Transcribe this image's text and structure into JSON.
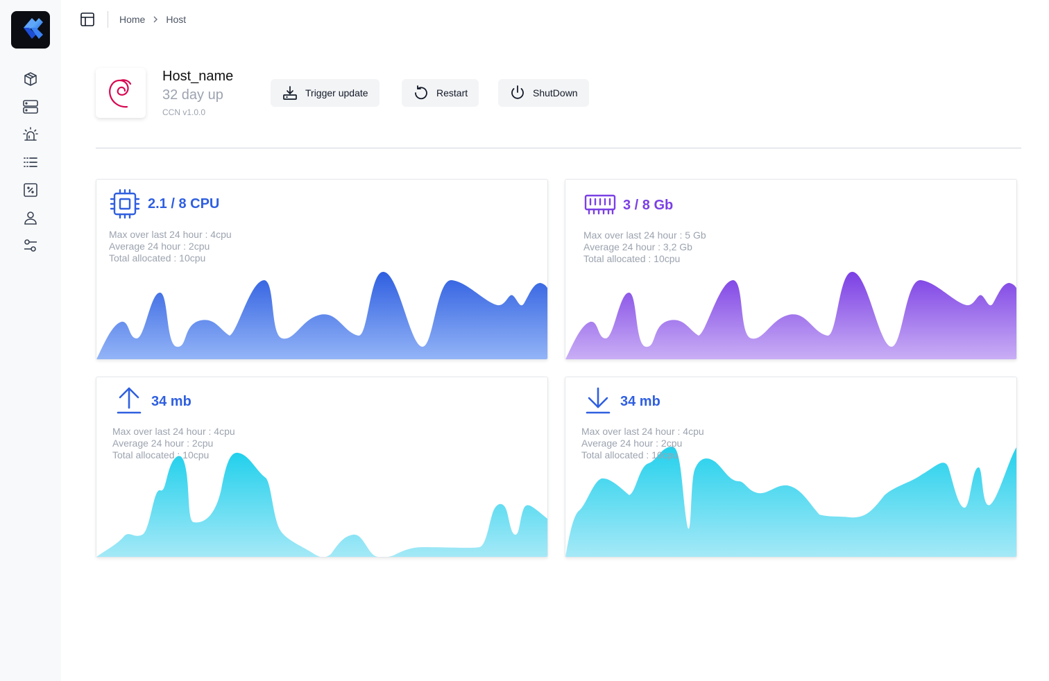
{
  "breadcrumb": {
    "home": "Home",
    "current": "Host"
  },
  "host": {
    "name": "Host_name",
    "uptime": "32 day up",
    "version": "CCN v1.0.0",
    "os_logo": "debian-swirl-icon"
  },
  "actions": {
    "trigger_update": "Trigger update",
    "restart": "Restart",
    "shutdown": "ShutDown"
  },
  "sidebar": {
    "items": [
      {
        "icon": "cube-icon"
      },
      {
        "icon": "server-icon"
      },
      {
        "icon": "alarm-icon"
      },
      {
        "icon": "list-icon"
      },
      {
        "icon": "percent-icon"
      },
      {
        "icon": "user-icon"
      },
      {
        "icon": "settings-sliders-icon"
      }
    ]
  },
  "colors": {
    "cpu": "#2f5fe0",
    "memory": "#7b3fe4",
    "network": "#1fc9e6",
    "accent_text": "#2f5fe0"
  },
  "cards": {
    "cpu": {
      "title": "2.1 / 8 CPU",
      "max": "Max over last 24 hour : 4cpu",
      "avg": "Average 24 hour : 2cpu",
      "total": "Total allocated : 10cpu"
    },
    "memory": {
      "title": "3 / 8 Gb",
      "max": "Max over last 24 hour : 5 Gb",
      "avg": "Average 24 hour : 3,2 Gb",
      "total": "Total allocated : 10cpu"
    },
    "upload": {
      "title": "34 mb",
      "max": "Max over last 24 hour : 4cpu",
      "avg": "Average 24 hour : 2cpu",
      "total": "Total allocated : 10cpu"
    },
    "download": {
      "title": "34 mb",
      "max": "Max over last 24 hour : 4cpu",
      "avg": "Average 24 hour : 2cpu",
      "total": "Total allocated : 10cpu"
    }
  }
}
